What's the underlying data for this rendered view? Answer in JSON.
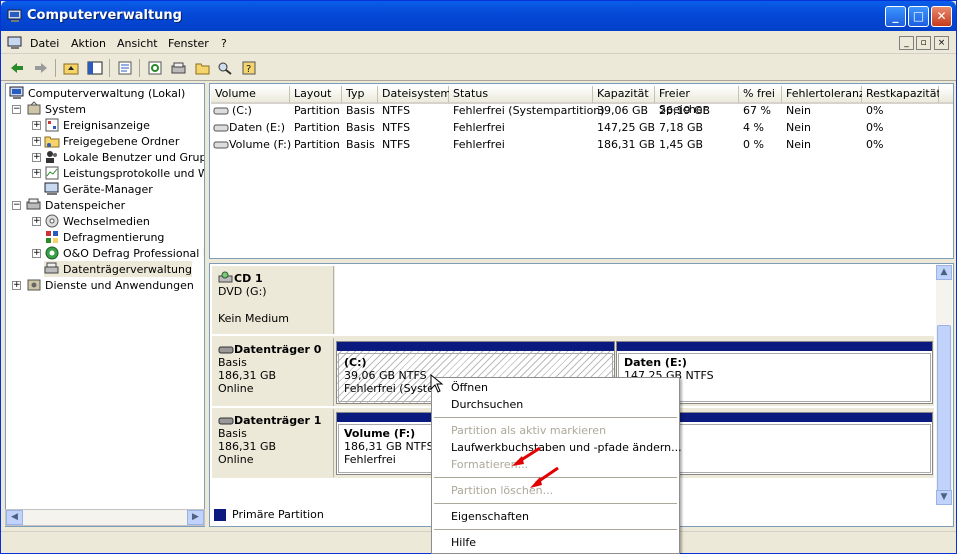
{
  "window": {
    "title": "Computerverwaltung",
    "min": "_",
    "max": "□",
    "close": "✕"
  },
  "menu": [
    "Datei",
    "Aktion",
    "Ansicht",
    "Fenster",
    "?"
  ],
  "mdi": [
    "_",
    "▫",
    "×"
  ],
  "tree": [
    {
      "label": "Computerverwaltung (Lokal)"
    },
    {
      "label": "System"
    },
    {
      "label": "Ereignisanzeige"
    },
    {
      "label": "Freigegebene Ordner"
    },
    {
      "label": "Lokale Benutzer und Gruppen"
    },
    {
      "label": "Leistungsprotokolle und Warnungen"
    },
    {
      "label": "Geräte-Manager"
    },
    {
      "label": "Datenspeicher"
    },
    {
      "label": "Wechselmedien"
    },
    {
      "label": "Defragmentierung"
    },
    {
      "label": "O&O Defrag Professional Edition"
    },
    {
      "label": "Datenträgerverwaltung"
    },
    {
      "label": "Dienste und Anwendungen"
    }
  ],
  "columns": [
    "Volume",
    "Layout",
    "Typ",
    "Dateisystem",
    "Status",
    "Kapazität",
    "Freier Speicher",
    "% frei",
    "Fehlertoleranz",
    "Restkapazität"
  ],
  "rows": [
    [
      "(C:)",
      "Partition",
      "Basis",
      "NTFS",
      "Fehlerfrei (Systempartition)",
      "39,06 GB",
      "26,19 GB",
      "67 %",
      "Nein",
      "0%"
    ],
    [
      "Daten (E:)",
      "Partition",
      "Basis",
      "NTFS",
      "Fehlerfrei",
      "147,25 GB",
      "7,18 GB",
      "4 %",
      "Nein",
      "0%"
    ],
    [
      "Volume (F:)",
      "Partition",
      "Basis",
      "NTFS",
      "Fehlerfrei",
      "186,31 GB",
      "1,45 GB",
      "0 %",
      "Nein",
      "0%"
    ]
  ],
  "disks": {
    "cd": {
      "name": "CD 1",
      "type": "DVD (G:)",
      "state": "Kein Medium"
    },
    "d0": {
      "name": "Datenträger 0",
      "type": "Basis",
      "size": "186,31 GB",
      "state": "Online",
      "p1": {
        "name": "(C:)",
        "size": "39,06 GB NTFS",
        "status": "Fehlerfrei (System"
      },
      "p2": {
        "name": "Daten  (E:)",
        "size": "147,25 GB NTFS"
      }
    },
    "d1": {
      "name": "Datenträger 1",
      "type": "Basis",
      "size": "186,31 GB",
      "state": "Online",
      "p1": {
        "name": "Volume  (F:)",
        "size": "186,31 GB NTFS",
        "status": "Fehlerfrei"
      }
    }
  },
  "legend": "Primäre Partition",
  "context_menu": [
    {
      "label": "Öffnen",
      "enabled": true
    },
    {
      "label": "Durchsuchen",
      "enabled": true
    },
    {
      "label": "Partition als aktiv markieren",
      "enabled": false
    },
    {
      "label": "Laufwerkbuchstaben und -pfade ändern...",
      "enabled": true
    },
    {
      "label": "Formatieren...",
      "enabled": false
    },
    {
      "label": "Partition löschen...",
      "enabled": false
    },
    {
      "label": "Eigenschaften",
      "enabled": true
    },
    {
      "label": "Hilfe",
      "enabled": true
    }
  ],
  "colors": {
    "accent": "#0a1a7e",
    "arrow": "#e00000"
  }
}
